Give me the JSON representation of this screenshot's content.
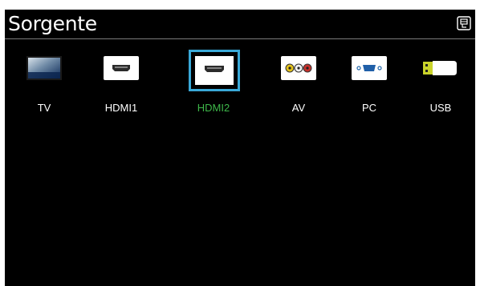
{
  "header": {
    "title": "Sorgente",
    "menu_icon": "tools-menu-icon"
  },
  "sources": [
    {
      "label": "TV",
      "icon": "tv-icon"
    },
    {
      "label": "HDMI1",
      "icon": "hdmi-port-icon"
    },
    {
      "label": "HDMI2",
      "icon": "hdmi-port-icon",
      "selected": true
    },
    {
      "label": "AV",
      "icon": "av-rca-ports-icon"
    },
    {
      "label": "PC",
      "icon": "vga-port-icon"
    },
    {
      "label": "USB",
      "icon": "usb-drive-icon"
    }
  ],
  "colors": {
    "background": "#000000",
    "selected_text": "#3eb84a",
    "focus_ring": "#3aa9d8",
    "text": "#ffffff"
  }
}
